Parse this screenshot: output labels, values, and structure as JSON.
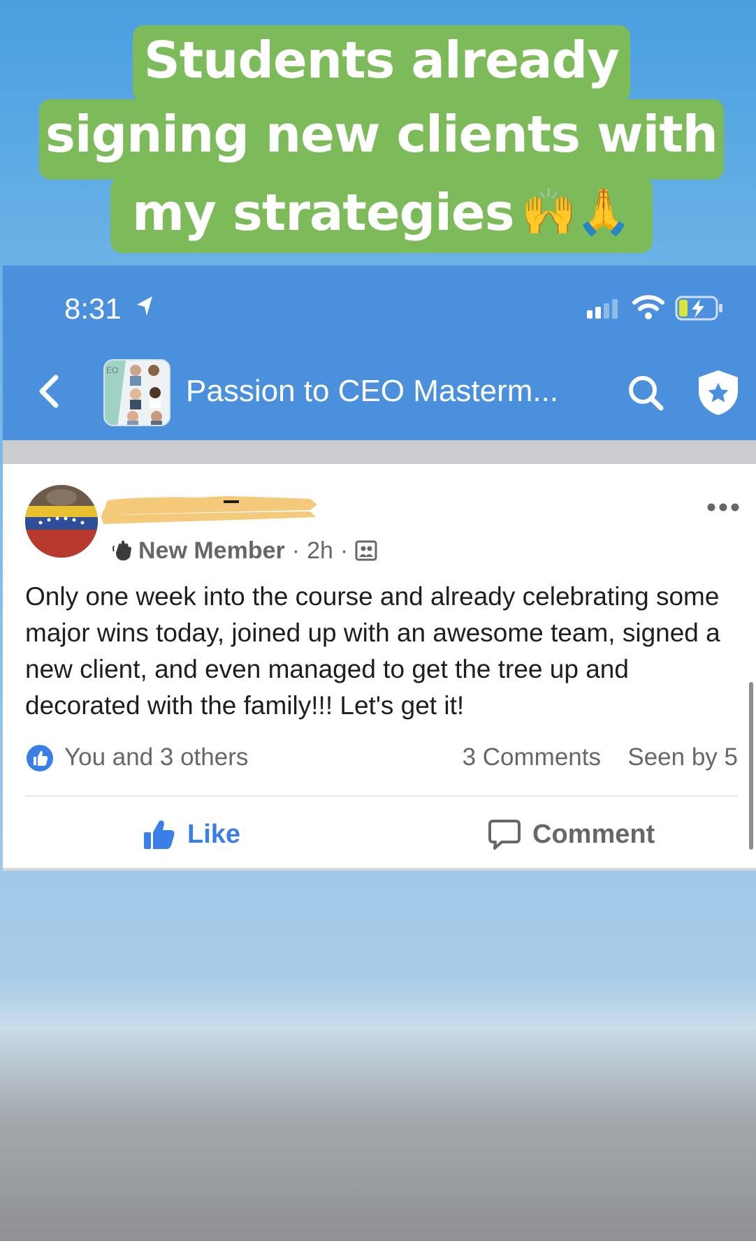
{
  "caption": {
    "line1": "Students already",
    "line2": "signing new clients with",
    "line3": "my strategies",
    "emoji": "🙌🙏"
  },
  "status_bar": {
    "time": "8:31"
  },
  "header": {
    "group_name": "Passion to CEO Masterm...",
    "thumb_text": "EO"
  },
  "post": {
    "author_role": "New Member",
    "time_ago": "2h",
    "body": "Only one week into the course and already celebrating some major wins today, joined up with an awesome team, signed a new client, and even managed to get the tree up and decorated with the family!!! Let's get it!",
    "reactions_text": "You and 3 others",
    "comments_count": "3 Comments",
    "seen_by": "Seen by 5"
  },
  "actions": {
    "like_label": "Like",
    "comment_label": "Comment"
  },
  "colors": {
    "caption_bg": "#7dbb5a",
    "header_blue": "#4a90dc",
    "like_blue": "#3a7fe8",
    "redaction": "#f5c97a"
  }
}
